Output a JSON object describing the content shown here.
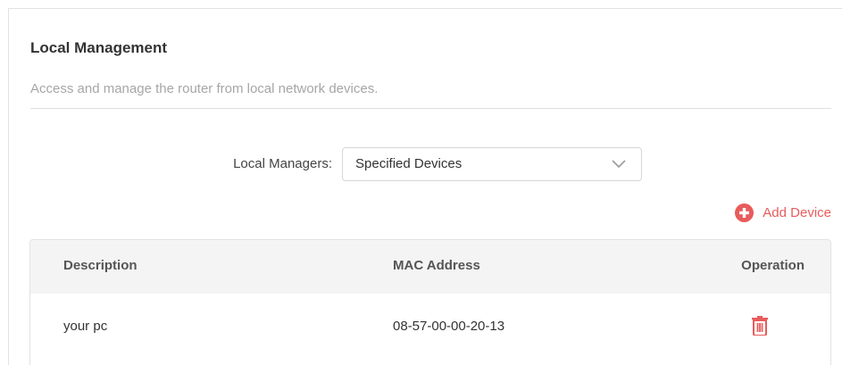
{
  "section": {
    "title": "Local Management",
    "subtitle": "Access and manage the router from local network devices."
  },
  "local_managers": {
    "label": "Local Managers:",
    "selected": "Specified Devices"
  },
  "add_device": {
    "label": "Add Device",
    "icon": "plus-circle-icon",
    "color": "#e85c5c"
  },
  "table": {
    "headers": {
      "description": "Description",
      "mac": "MAC Address",
      "operation": "Operation"
    },
    "rows": [
      {
        "description": "your pc",
        "mac": "08-57-00-00-20-13",
        "operation_icon": "trash-icon"
      }
    ]
  },
  "colors": {
    "accent": "#e85c5c",
    "header_bg": "#f4f4f4"
  }
}
